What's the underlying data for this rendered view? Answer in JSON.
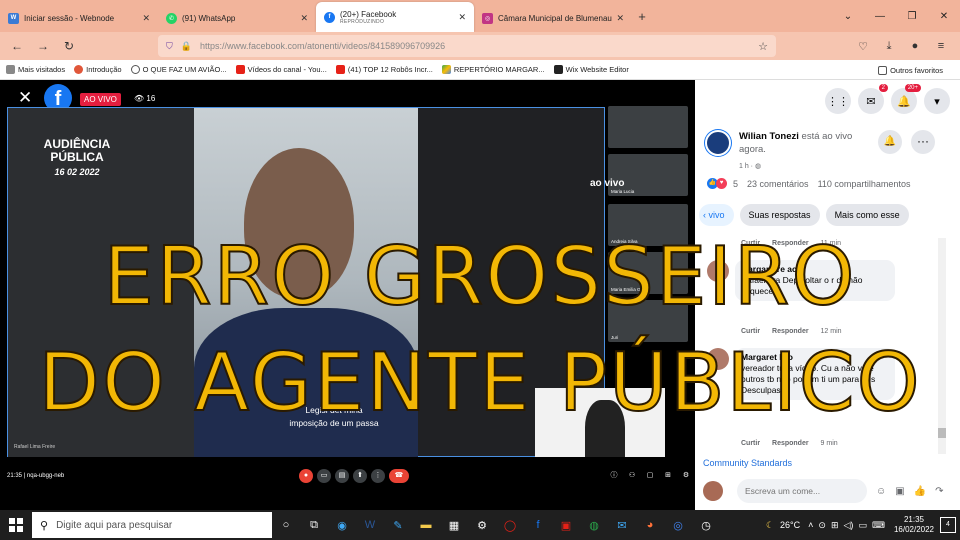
{
  "browser": {
    "tabs": [
      {
        "title": "Iniciar sessão - Webnode",
        "icon": "webnode-icon",
        "color": "#3b7bd4"
      },
      {
        "title": "(91) WhatsApp",
        "icon": "whatsapp-icon",
        "color": "#25d366"
      },
      {
        "title": "(20+) Facebook",
        "subtitle": "REPRODUZINDO",
        "icon": "facebook-icon",
        "color": "#1877f2"
      },
      {
        "title": "Câmara Municipal de Blumenau",
        "icon": "instagram-icon",
        "color": "#c13584"
      }
    ],
    "url": "https://www.facebook.com/atonenti/videos/841589096709926",
    "url_host": "www.facebook.com",
    "bookmarks": [
      {
        "label": "Mais visitados"
      },
      {
        "label": "Introdução"
      },
      {
        "label": "O QUE FAZ UM AVIÃO..."
      },
      {
        "label": "Vídeos do canal - You..."
      },
      {
        "label": "(41) TOP 12 Robôs Incr..."
      },
      {
        "label": "REPERTÓRIO MARGAR..."
      },
      {
        "label": "Wix Website Editor"
      }
    ],
    "other_bookmarks": "Outros favoritos"
  },
  "video": {
    "live_label": "AO VIVO",
    "viewers": "16",
    "event_title_line1": "AUDIÊNCIA",
    "event_title_line2": "PÚBLICA",
    "event_date": "16 02 2022",
    "caption_line1": "Legisl    det    mina",
    "caption_line2": "imposição de um passa",
    "speaker_name": "Rafael Lima Freire",
    "aovivo_watermark": "ao vivo",
    "thumb_names": [
      "",
      "Maria Lucia",
      "Andreia Silva",
      "Maria Emilia Gaio",
      "Juri"
    ],
    "meeting_code": "21:35 | nqa-ubgg-neb"
  },
  "overlay": {
    "line1": "ERRO GROSSEIRO",
    "line2": "DO AGENTE PÚBLICO",
    "color": "#f2b705"
  },
  "panel": {
    "notif_messenger": "2",
    "notif_bell": "20+",
    "poster_name": "Wilian Tonezi",
    "poster_status": "está ao vivo agora.",
    "poster_time": "1 h",
    "reaction_count": "5",
    "comments_count": "23 comentários",
    "shares_count": "110 compartilhamentos",
    "filters": [
      "vivo",
      "Suas respostas",
      "Mais como esse"
    ],
    "comments": [
      {
        "name": "Margar    Fre    ach",
        "text": "Rafael     bra    Depo    oltar o r     de não esquecer.",
        "like": "Curtir",
        "reply": "Responder",
        "time": "12 min"
      },
      {
        "name": "Margaret Fro",
        "text": "vereador tuca      vídeo. Cu   a não ve    e outros tb não podem ti    um    para nós    Desculpas",
        "like": "Curtir",
        "reply": "Responder",
        "time": "9 min"
      }
    ],
    "top_comment_meta": {
      "like": "Curtir",
      "reply": "Responder",
      "time": "11 min"
    },
    "community_standards": "Community Standards",
    "comment_placeholder": "Escreva um come..."
  },
  "taskbar": {
    "search_placeholder": "Digite aqui para pesquisar",
    "weather": "26°C",
    "time": "21:35",
    "date": "16/02/2022",
    "notifications": "4"
  }
}
